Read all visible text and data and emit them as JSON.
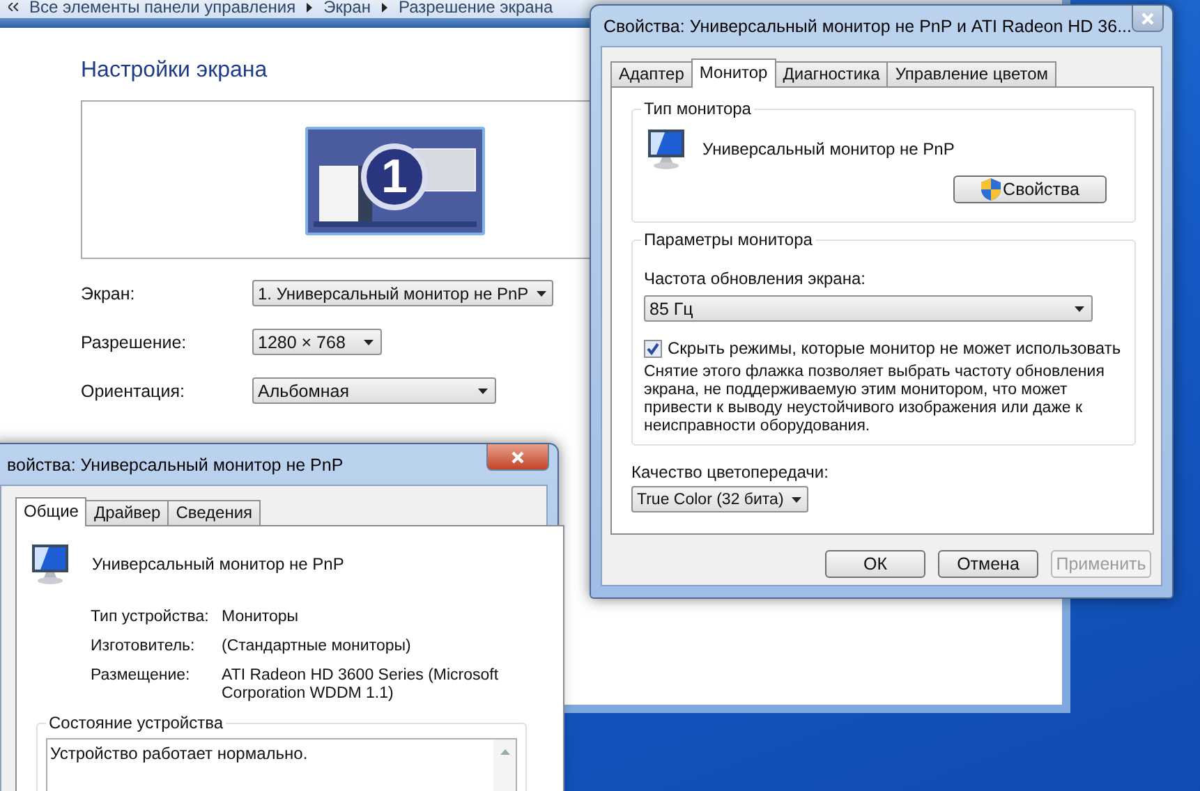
{
  "control_panel": {
    "breadcrumb": [
      "Все элементы панели управления",
      "Экран",
      "Разрешение экрана"
    ],
    "heading": "Настройки экрана",
    "display_number": "1",
    "settings": [
      {
        "label": "Экран:",
        "value": "1. Универсальный монитор не PnP"
      },
      {
        "label": "Разрешение:",
        "value": "1280 × 768"
      },
      {
        "label": "Ориентация:",
        "value": "Альбомная"
      }
    ]
  },
  "monitor_dialog": {
    "title": "Свойства: Универсальный монитор не PnP и ATI Radeon HD 36...",
    "tabs": [
      {
        "label": "Адаптер",
        "selected": false
      },
      {
        "label": "Монитор",
        "selected": true
      },
      {
        "label": "Диагностика",
        "selected": false
      },
      {
        "label": "Управление цветом",
        "selected": false
      }
    ],
    "monitor_type": {
      "legend": "Тип монитора",
      "name": "Универсальный монитор не PnP",
      "button": "Свойства"
    },
    "monitor_settings": {
      "legend": "Параметры монитора",
      "refresh_label": "Частота обновления экрана:",
      "refresh_value": "85 Гц",
      "hide_modes": {
        "label": "Скрыть режимы, которые монитор не может использовать",
        "checked": true
      },
      "note": "Снятие этого флажка позволяет выбрать частоту обновления экрана, не поддерживаемую этим монитором, что может привести к выводу неустойчивого изображения или даже к неисправности оборудования."
    },
    "color_label": "Качество цветопередачи:",
    "color_value": "True Color (32 бита)",
    "buttons": [
      {
        "label": "ОК",
        "disabled": false
      },
      {
        "label": "Отмена",
        "disabled": false
      },
      {
        "label": "Применить",
        "disabled": true
      }
    ]
  },
  "device_dialog": {
    "title": "войства: Универсальный монитор не PnP",
    "tabs": [
      {
        "label": "Общие",
        "selected": true
      },
      {
        "label": "Драйвер",
        "selected": false
      },
      {
        "label": "Сведения",
        "selected": false
      }
    ],
    "device_name": "Универсальный монитор не PnP",
    "properties": [
      {
        "label": "Тип устройства:",
        "value": "Мониторы"
      },
      {
        "label": "Изготовитель:",
        "value": "(Стандартные мониторы)"
      },
      {
        "label": "Размещение:",
        "value": "ATI Radeon HD 3600 Series (Microsoft Corporation WDDM 1.1)"
      }
    ],
    "status_legend": "Состояние устройства",
    "status_text": "Устройство работает нормально."
  }
}
